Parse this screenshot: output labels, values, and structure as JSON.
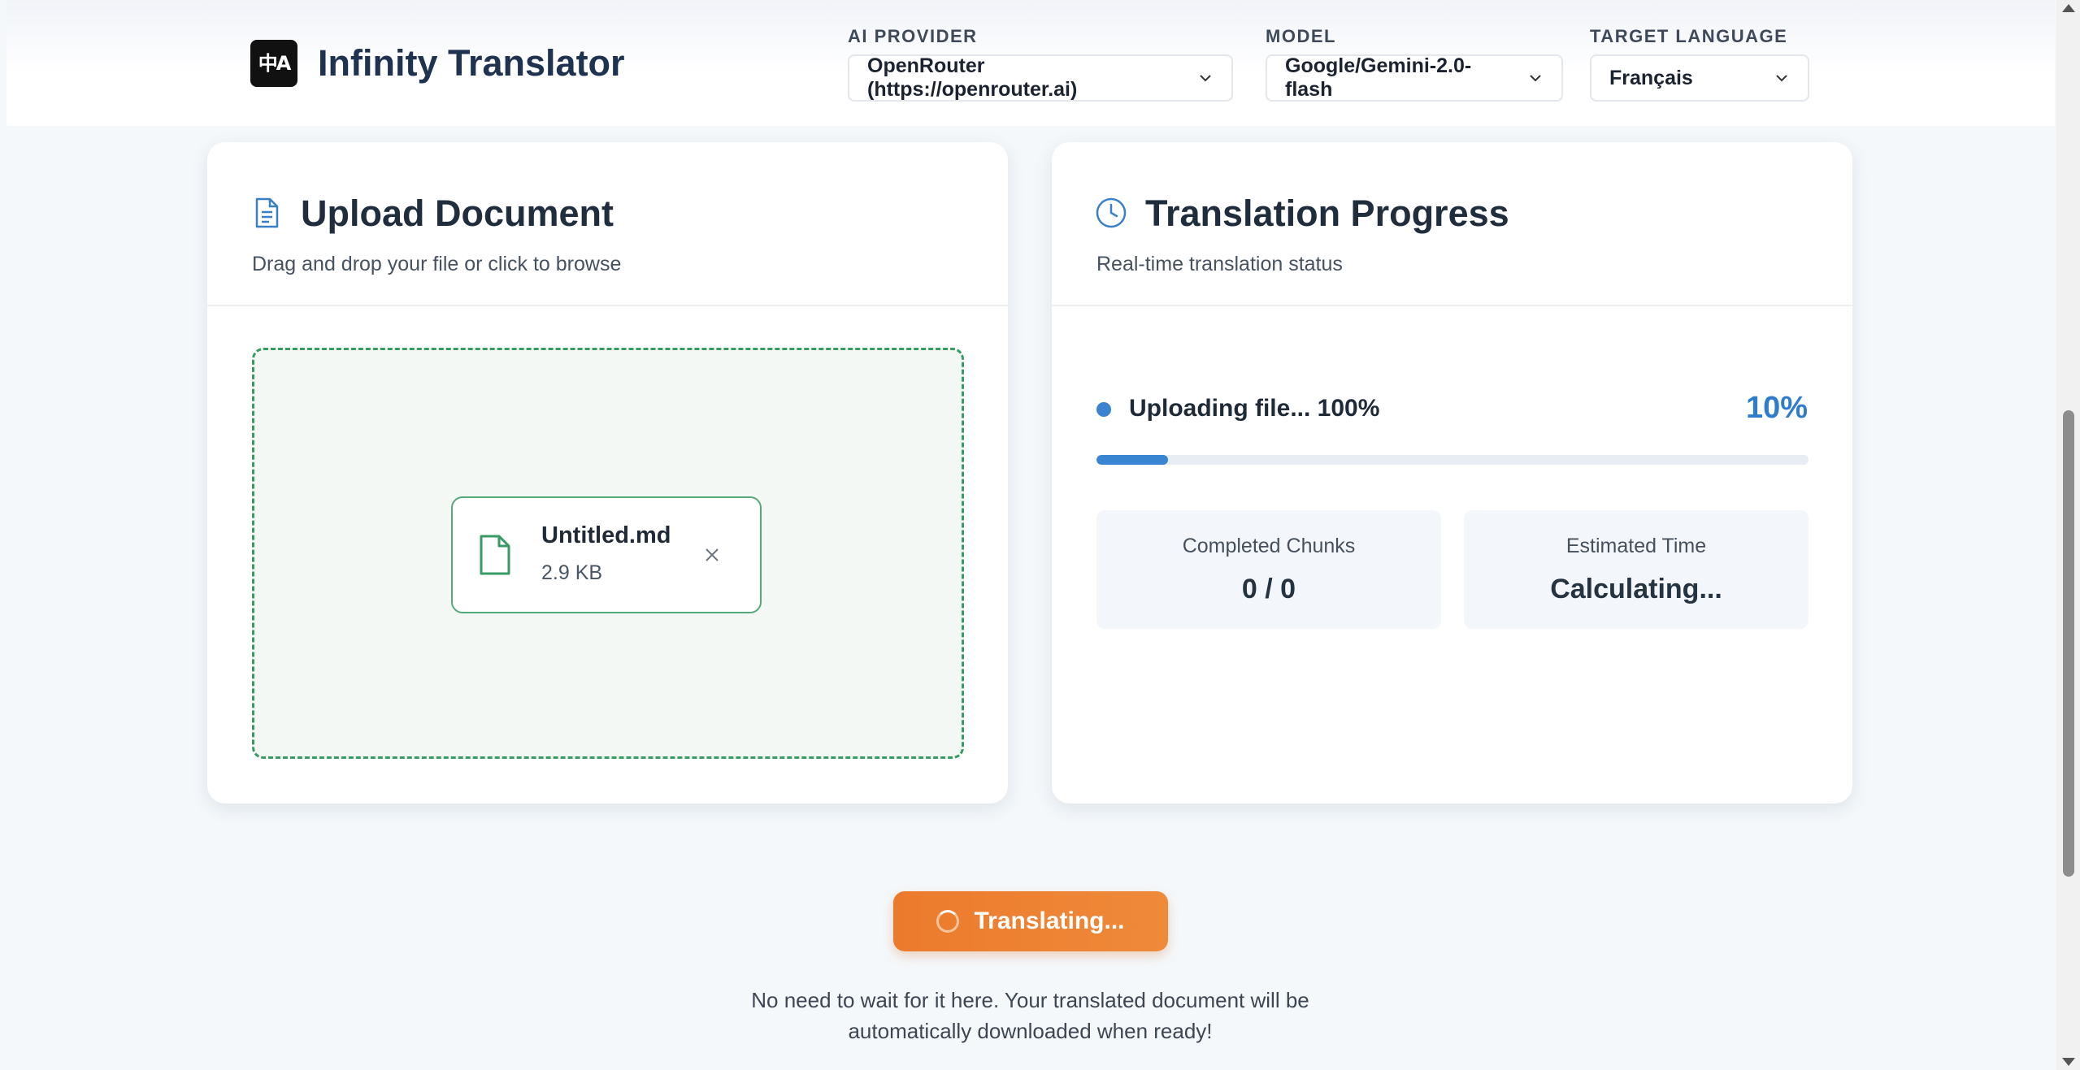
{
  "header": {
    "logo_glyph": "中A",
    "title": "Infinity Translator",
    "provider": {
      "label": "AI PROVIDER",
      "value": "OpenRouter (https://openrouter.ai)"
    },
    "model": {
      "label": "MODEL",
      "value": "Google/Gemini-2.0-flash"
    },
    "language": {
      "label": "TARGET LANGUAGE",
      "value": "Français"
    }
  },
  "upload": {
    "title": "Upload Document",
    "subtitle": "Drag and drop your file or click to browse",
    "file": {
      "name": "Untitled.md",
      "size": "2.9 KB"
    }
  },
  "progress": {
    "title": "Translation Progress",
    "subtitle": "Real-time translation status",
    "status_text": "Uploading file... 100%",
    "percent_text": "10%",
    "percent_value": 0.1,
    "completed": {
      "label": "Completed Chunks",
      "value": "0 / 0"
    },
    "estimated": {
      "label": "Estimated Time",
      "value": "Calculating..."
    }
  },
  "action": {
    "button_label": "Translating...",
    "note_line1": "No need to wait for it here. Your translated document will be",
    "note_line2": "automatically downloaded when ready!"
  },
  "colors": {
    "accent_blue": "#3a85d2",
    "accent_orange": "#ec7a2c",
    "accent_green": "#3a9a63"
  }
}
